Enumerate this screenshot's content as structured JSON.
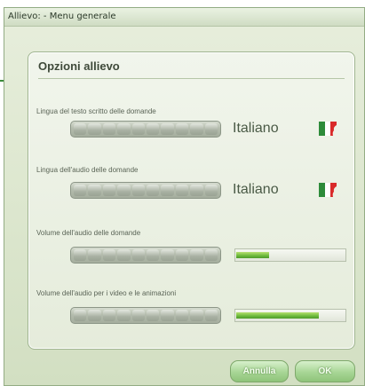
{
  "window": {
    "title": "Allievo:  - Menu generale"
  },
  "panel": {
    "title": "Opzioni allievo",
    "options": [
      {
        "label": "Lingua del testo scritto delle domande",
        "value": "Italiano",
        "flag": "italy-flag"
      },
      {
        "label": "Lingua dell'audio delle domande",
        "value": "Italiano",
        "flag": "italy-flag"
      },
      {
        "label": "Volume dell'audio delle domande",
        "volume_fraction": 0.3
      },
      {
        "label": "Volume dell'audio per i video e le animazioni",
        "volume_fraction": 0.75
      }
    ]
  },
  "buttons": {
    "cancel_label": "Annulla",
    "ok_label": "OK"
  },
  "colors": {
    "accent_green": "#6ab83b",
    "flag_green": "#2e8b3a",
    "flag_white": "#ffffff",
    "flag_red": "#d92a2a"
  }
}
